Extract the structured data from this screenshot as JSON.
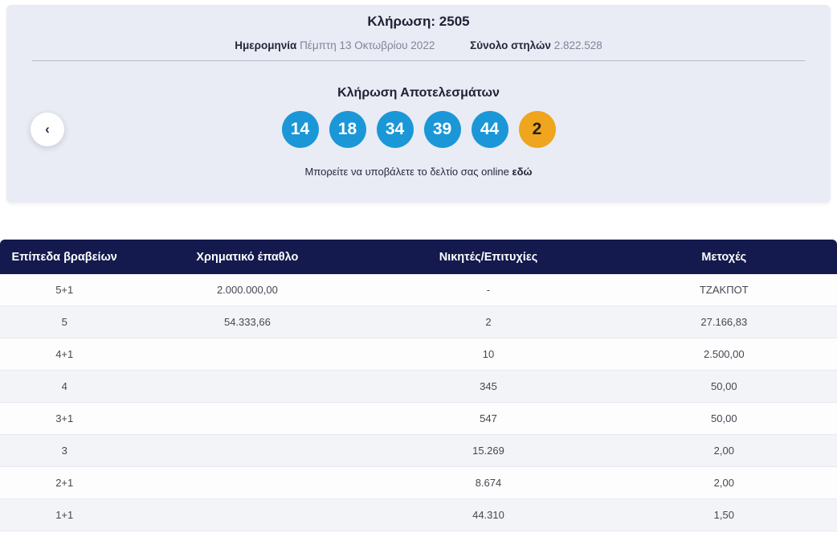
{
  "draw": {
    "title_label": "Κλήρωση:",
    "number": "2505",
    "date_label": "Ημερομηνία",
    "date_value": "Πέμπτη 13 Οκτωβρίου 2022",
    "columns_label": "Σύνολο στηλών",
    "columns_value": "2.822.528",
    "results_title": "Κλήρωση Αποτελεσμάτων",
    "numbers": [
      "14",
      "18",
      "34",
      "39",
      "44"
    ],
    "bonus": "2",
    "note_text": "Μπορείτε να υποβάλετε το δελτίο σας online",
    "note_link": "εδώ",
    "prev_icon": "‹"
  },
  "colors": {
    "ball_blue": "#1b97d8",
    "ball_bonus": "#f0a51e",
    "table_header": "#141a4d"
  },
  "table": {
    "headers": [
      "Επίπεδα βραβείων",
      "Χρηματικό έπαθλο",
      "Νικητές/Επιτυχίες",
      "Μετοχές"
    ],
    "rows": [
      [
        "5+1",
        "2.000.000,00",
        "-",
        "ΤΖΑΚΠΟΤ"
      ],
      [
        "5",
        "54.333,66",
        "2",
        "27.166,83"
      ],
      [
        "4+1",
        "",
        "10",
        "2.500,00"
      ],
      [
        "4",
        "",
        "345",
        "50,00"
      ],
      [
        "3+1",
        "",
        "547",
        "50,00"
      ],
      [
        "3",
        "",
        "15.269",
        "2,00"
      ],
      [
        "2+1",
        "",
        "8.674",
        "2,00"
      ],
      [
        "1+1",
        "",
        "44.310",
        "1,50"
      ]
    ]
  }
}
